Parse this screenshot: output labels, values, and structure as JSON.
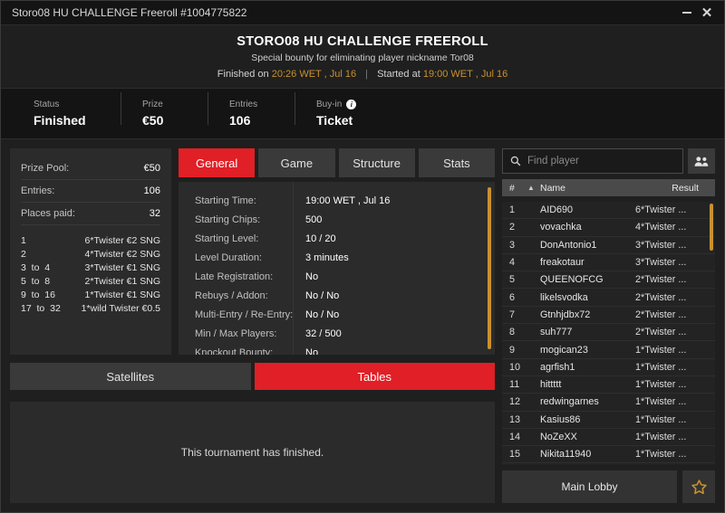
{
  "titlebar": {
    "text": "Storo08 HU CHALLENGE Freeroll #1004775822",
    "minimize_icon": "minimize-icon",
    "close_label": "✕"
  },
  "header": {
    "title": "STORO08 HU CHALLENGE FREEROLL",
    "subtitle": "Special bounty for eliminating player nickname Tor08",
    "finished_prefix": "Finished on",
    "finished_time": "20:26 WET , Jul 16",
    "separator": "|",
    "started_prefix": "Started at",
    "started_time": "19:00 WET , Jul 16"
  },
  "stats": [
    {
      "label": "Status",
      "value": "Finished",
      "info": false
    },
    {
      "label": "Prize",
      "value": "€50",
      "info": false
    },
    {
      "label": "Entries",
      "value": "106",
      "info": false
    },
    {
      "label": "Buy-in",
      "value": "Ticket",
      "info": true,
      "info_glyph": "i"
    }
  ],
  "prize_panel": {
    "rows": [
      {
        "key": "Prize Pool:",
        "value": "€50"
      },
      {
        "key": "Entries:",
        "value": "106"
      },
      {
        "key": "Places paid:",
        "value": "32"
      }
    ],
    "payouts": [
      {
        "place": "1",
        "prize": "6*Twister €2 SNG"
      },
      {
        "place": "2",
        "prize": "4*Twister €2 SNG"
      },
      {
        "place": "3  to  4",
        "prize": "3*Twister €1 SNG"
      },
      {
        "place": "5  to  8",
        "prize": "2*Twister €1 SNG"
      },
      {
        "place": "9  to  16",
        "prize": "1*Twister €1 SNG"
      },
      {
        "place": "17  to  32",
        "prize": "1*wild Twister €0.5"
      }
    ]
  },
  "tabs": [
    {
      "label": "General",
      "active": true
    },
    {
      "label": "Game",
      "active": false
    },
    {
      "label": "Structure",
      "active": false
    },
    {
      "label": "Stats",
      "active": false
    }
  ],
  "details": [
    {
      "key": "Starting Time:",
      "value": "19:00 WET , Jul 16"
    },
    {
      "key": "Starting Chips:",
      "value": "500"
    },
    {
      "key": "Starting Level:",
      "value": "10 / 20"
    },
    {
      "key": "Level Duration:",
      "value": "3 minutes"
    },
    {
      "key": "Late Registration:",
      "value": "No"
    },
    {
      "key": "Rebuys / Addon:",
      "value": "No / No"
    },
    {
      "key": "Multi-Entry / Re-Entry:",
      "value": "No / No"
    },
    {
      "key": "Min / Max Players:",
      "value": "32 / 500"
    },
    {
      "key": "Knockout Bounty:",
      "value": "No"
    }
  ],
  "sub_tabs": [
    {
      "label": "Satellites",
      "active": false
    },
    {
      "label": "Tables",
      "active": true
    }
  ],
  "finished_message": "This tournament has finished.",
  "search": {
    "placeholder": "Find player",
    "value": "",
    "search_icon": "search-icon",
    "people_icon": "people-icon"
  },
  "player_table": {
    "columns": {
      "num": "#",
      "sort": "▲",
      "name": "Name",
      "result": "Result"
    },
    "rows": [
      {
        "num": "1",
        "name": "AID690",
        "result": "6*Twister ..."
      },
      {
        "num": "2",
        "name": "vovachka",
        "result": "4*Twister ..."
      },
      {
        "num": "3",
        "name": "DonAntonio1",
        "result": "3*Twister ..."
      },
      {
        "num": "4",
        "name": "freakotaur",
        "result": "3*Twister ..."
      },
      {
        "num": "5",
        "name": "QUEENOFCG",
        "result": "2*Twister ..."
      },
      {
        "num": "6",
        "name": "likelsvodka",
        "result": "2*Twister ..."
      },
      {
        "num": "7",
        "name": "Gtnhjdbx72",
        "result": "2*Twister ..."
      },
      {
        "num": "8",
        "name": "suh777",
        "result": "2*Twister ..."
      },
      {
        "num": "9",
        "name": "mogican23",
        "result": "1*Twister ..."
      },
      {
        "num": "10",
        "name": "agrfish1",
        "result": "1*Twister ..."
      },
      {
        "num": "11",
        "name": "hittttt",
        "result": "1*Twister ..."
      },
      {
        "num": "12",
        "name": "redwingarnes",
        "result": "1*Twister ..."
      },
      {
        "num": "13",
        "name": "Kasius86",
        "result": "1*Twister ..."
      },
      {
        "num": "14",
        "name": "NoZeXX",
        "result": "1*Twister ..."
      },
      {
        "num": "15",
        "name": "Nikita11940",
        "result": "1*Twister ..."
      }
    ]
  },
  "footer": {
    "main_lobby_label": "Main Lobby",
    "star_icon": "star-icon"
  },
  "colors": {
    "accent_red": "#e01f26",
    "gold": "#c8912f",
    "panel": "#2b2b2b",
    "background": "#1f1f1f"
  }
}
